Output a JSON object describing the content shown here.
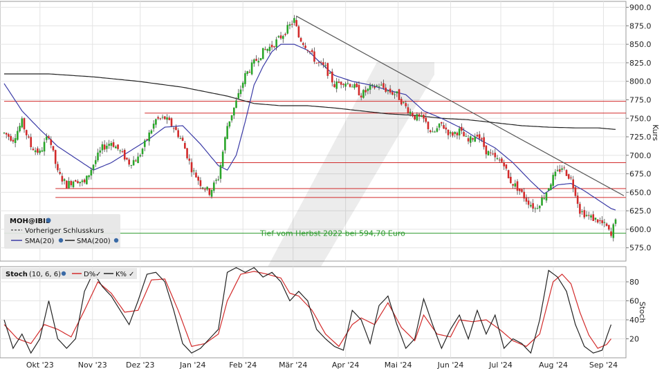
{
  "chart_data": [
    {
      "type": "candlestick",
      "legend": {
        "symbol": "MOH@IBIS",
        "items": [
          {
            "label": "Vorheriger Schlusskurs",
            "color": "#444444",
            "style": "dashed"
          },
          {
            "label": "SMA(20)",
            "color": "#3a3aa6",
            "style": "solid"
          },
          {
            "label": "SMA(200)",
            "color": "#222222",
            "style": "solid"
          }
        ]
      },
      "ylabel": "Kurs",
      "ylim": [
        557,
        908
      ],
      "yticks": [
        575,
        600,
        625,
        650,
        675,
        700,
        725,
        750,
        775,
        800,
        825,
        850,
        875,
        900
      ],
      "ytick_labels": [
        "575.0",
        "600.0",
        "625.0",
        "650.0",
        "675.0",
        "700.0",
        "725.0",
        "750.0",
        "775.0",
        "800.0",
        "825.0",
        "850.0",
        "875.0",
        "900.0"
      ],
      "x_months": [
        "Okt '23",
        "Nov '23",
        "Dez '23",
        "Jan '24",
        "Feb '24",
        "Mär '24",
        "Apr '24",
        "Mai '24",
        "Jun '24",
        "Jul '24",
        "Aug '24",
        "Sep '24"
      ],
      "x_month_pos": [
        15,
        37,
        57,
        79,
        100,
        121,
        143,
        165,
        187,
        208,
        230,
        251
      ],
      "n_days": 275,
      "candles_anchor": [
        [
          0,
          730
        ],
        [
          4,
          722
        ],
        [
          8,
          745
        ],
        [
          12,
          712
        ],
        [
          16,
          703
        ],
        [
          20,
          728
        ],
        [
          24,
          676
        ],
        [
          28,
          660
        ],
        [
          32,
          668
        ],
        [
          36,
          662
        ],
        [
          40,
          688
        ],
        [
          44,
          710
        ],
        [
          48,
          718
        ],
        [
          52,
          705
        ],
        [
          56,
          690
        ],
        [
          60,
          696
        ],
        [
          64,
          722
        ],
        [
          68,
          748
        ],
        [
          72,
          750
        ],
        [
          76,
          738
        ],
        [
          80,
          718
        ],
        [
          84,
          682
        ],
        [
          88,
          662
        ],
        [
          92,
          650
        ],
        [
          96,
          670
        ],
        [
          100,
          740
        ],
        [
          104,
          772
        ],
        [
          108,
          808
        ],
        [
          112,
          825
        ],
        [
          116,
          840
        ],
        [
          120,
          848
        ],
        [
          124,
          860
        ],
        [
          128,
          875
        ],
        [
          130,
          883
        ],
        [
          132,
          860
        ],
        [
          136,
          845
        ],
        [
          140,
          825
        ],
        [
          144,
          818
        ],
        [
          148,
          795
        ],
        [
          152,
          800
        ],
        [
          156,
          795
        ],
        [
          160,
          782
        ],
        [
          164,
          790
        ],
        [
          168,
          795
        ],
        [
          172,
          787
        ],
        [
          176,
          782
        ],
        [
          180,
          765
        ],
        [
          184,
          752
        ],
        [
          188,
          748
        ],
        [
          192,
          728
        ],
        [
          196,
          742
        ],
        [
          200,
          728
        ],
        [
          204,
          733
        ],
        [
          208,
          718
        ],
        [
          212,
          730
        ],
        [
          216,
          706
        ],
        [
          220,
          695
        ],
        [
          224,
          690
        ],
        [
          226,
          668
        ],
        [
          230,
          656
        ],
        [
          234,
          640
        ],
        [
          238,
          628
        ],
        [
          242,
          645
        ],
        [
          246,
          670
        ],
        [
          250,
          684
        ],
        [
          254,
          668
        ],
        [
          256,
          650
        ],
        [
          258,
          625
        ],
        [
          262,
          617
        ],
        [
          266,
          612
        ],
        [
          270,
          603
        ],
        [
          272,
          590
        ],
        [
          274,
          617
        ]
      ],
      "sma20_anchor": [
        [
          0,
          797
        ],
        [
          8,
          760
        ],
        [
          16,
          735
        ],
        [
          24,
          712
        ],
        [
          32,
          696
        ],
        [
          40,
          680
        ],
        [
          48,
          690
        ],
        [
          56,
          705
        ],
        [
          64,
          720
        ],
        [
          72,
          738
        ],
        [
          80,
          740
        ],
        [
          88,
          715
        ],
        [
          96,
          686
        ],
        [
          100,
          680
        ],
        [
          104,
          700
        ],
        [
          108,
          745
        ],
        [
          112,
          795
        ],
        [
          116,
          820
        ],
        [
          120,
          840
        ],
        [
          124,
          850
        ],
        [
          130,
          850
        ],
        [
          136,
          842
        ],
        [
          140,
          830
        ],
        [
          148,
          808
        ],
        [
          156,
          800
        ],
        [
          164,
          795
        ],
        [
          172,
          788
        ],
        [
          180,
          782
        ],
        [
          188,
          760
        ],
        [
          196,
          750
        ],
        [
          204,
          738
        ],
        [
          212,
          723
        ],
        [
          220,
          710
        ],
        [
          228,
          690
        ],
        [
          236,
          665
        ],
        [
          242,
          648
        ],
        [
          248,
          660
        ],
        [
          254,
          662
        ],
        [
          260,
          652
        ],
        [
          266,
          640
        ],
        [
          272,
          628
        ],
        [
          274,
          626
        ]
      ],
      "sma200_anchor": [
        [
          0,
          810
        ],
        [
          20,
          810
        ],
        [
          40,
          806
        ],
        [
          60,
          800
        ],
        [
          80,
          792
        ],
        [
          100,
          780
        ],
        [
          112,
          770
        ],
        [
          124,
          767
        ],
        [
          136,
          767
        ],
        [
          148,
          764
        ],
        [
          160,
          760
        ],
        [
          172,
          756
        ],
        [
          184,
          754
        ],
        [
          196,
          750
        ],
        [
          208,
          748
        ],
        [
          220,
          744
        ],
        [
          232,
          740
        ],
        [
          244,
          738
        ],
        [
          256,
          737
        ],
        [
          266,
          737
        ],
        [
          274,
          735
        ]
      ],
      "horizontal_lines": [
        {
          "y": 773,
          "color": "#d22a2a",
          "x_from": 0
        },
        {
          "y": 757,
          "color": "#d22a2a",
          "x_from": 63
        },
        {
          "y": 690,
          "color": "#d22a2a",
          "x_from": 95
        },
        {
          "y": 655,
          "color": "#d22a2a",
          "x_from": 23
        },
        {
          "y": 643,
          "color": "#d22a2a",
          "x_from": 23
        },
        {
          "y": 594.7,
          "color": "#2c9a2c",
          "x_from": 0
        }
      ],
      "trendline": {
        "from": [
          131,
          888
        ],
        "to": [
          274,
          650
        ],
        "color": "#555555"
      },
      "annotation": {
        "text": "Tief vom Herbst 2022 bei 594,70 Euro",
        "x_day": 126,
        "y": 594.7
      }
    },
    {
      "type": "line",
      "legend": {
        "label": "Stoch",
        "params": "(10, 6, 6)",
        "items": [
          {
            "label": "D%",
            "color": "#d22a2a"
          },
          {
            "label": "K%",
            "color": "#222222"
          }
        ]
      },
      "ylabel": "Stoch",
      "ylim": [
        0,
        96
      ],
      "yticks": [
        20,
        40,
        60,
        80
      ],
      "ytick_labels": [
        "20",
        "40",
        "60",
        "80"
      ],
      "k_anchor": [
        [
          0,
          40
        ],
        [
          4,
          10
        ],
        [
          8,
          25
        ],
        [
          12,
          5
        ],
        [
          16,
          20
        ],
        [
          20,
          60
        ],
        [
          24,
          20
        ],
        [
          28,
          10
        ],
        [
          32,
          20
        ],
        [
          36,
          70
        ],
        [
          40,
          90
        ],
        [
          44,
          75
        ],
        [
          48,
          65
        ],
        [
          52,
          50
        ],
        [
          56,
          35
        ],
        [
          60,
          60
        ],
        [
          64,
          88
        ],
        [
          68,
          90
        ],
        [
          72,
          80
        ],
        [
          76,
          50
        ],
        [
          80,
          15
        ],
        [
          84,
          5
        ],
        [
          88,
          10
        ],
        [
          92,
          20
        ],
        [
          96,
          30
        ],
        [
          100,
          90
        ],
        [
          104,
          95
        ],
        [
          108,
          90
        ],
        [
          112,
          95
        ],
        [
          116,
          85
        ],
        [
          120,
          90
        ],
        [
          124,
          80
        ],
        [
          128,
          60
        ],
        [
          132,
          70
        ],
        [
          136,
          60
        ],
        [
          140,
          30
        ],
        [
          144,
          20
        ],
        [
          148,
          12
        ],
        [
          152,
          8
        ],
        [
          156,
          50
        ],
        [
          160,
          40
        ],
        [
          164,
          15
        ],
        [
          168,
          55
        ],
        [
          172,
          65
        ],
        [
          176,
          35
        ],
        [
          180,
          10
        ],
        [
          184,
          20
        ],
        [
          188,
          62
        ],
        [
          192,
          35
        ],
        [
          196,
          10
        ],
        [
          200,
          30
        ],
        [
          204,
          45
        ],
        [
          208,
          20
        ],
        [
          212,
          50
        ],
        [
          216,
          25
        ],
        [
          220,
          45
        ],
        [
          224,
          10
        ],
        [
          228,
          20
        ],
        [
          232,
          15
        ],
        [
          236,
          5
        ],
        [
          240,
          40
        ],
        [
          244,
          92
        ],
        [
          248,
          85
        ],
        [
          252,
          70
        ],
        [
          256,
          35
        ],
        [
          260,
          12
        ],
        [
          264,
          5
        ],
        [
          268,
          8
        ],
        [
          270,
          22
        ],
        [
          272,
          35
        ]
      ],
      "d_anchor": [
        [
          0,
          35
        ],
        [
          6,
          20
        ],
        [
          12,
          15
        ],
        [
          18,
          35
        ],
        [
          24,
          30
        ],
        [
          30,
          22
        ],
        [
          36,
          50
        ],
        [
          42,
          80
        ],
        [
          48,
          68
        ],
        [
          54,
          48
        ],
        [
          60,
          50
        ],
        [
          66,
          82
        ],
        [
          72,
          83
        ],
        [
          78,
          50
        ],
        [
          84,
          12
        ],
        [
          90,
          15
        ],
        [
          96,
          25
        ],
        [
          100,
          60
        ],
        [
          106,
          88
        ],
        [
          112,
          91
        ],
        [
          118,
          88
        ],
        [
          124,
          84
        ],
        [
          128,
          68
        ],
        [
          132,
          65
        ],
        [
          138,
          50
        ],
        [
          144,
          25
        ],
        [
          150,
          12
        ],
        [
          156,
          35
        ],
        [
          160,
          42
        ],
        [
          166,
          35
        ],
        [
          172,
          58
        ],
        [
          178,
          32
        ],
        [
          184,
          18
        ],
        [
          188,
          45
        ],
        [
          194,
          25
        ],
        [
          200,
          22
        ],
        [
          204,
          40
        ],
        [
          210,
          38
        ],
        [
          216,
          40
        ],
        [
          222,
          30
        ],
        [
          228,
          18
        ],
        [
          234,
          12
        ],
        [
          240,
          25
        ],
        [
          246,
          80
        ],
        [
          250,
          88
        ],
        [
          254,
          78
        ],
        [
          258,
          48
        ],
        [
          262,
          24
        ],
        [
          266,
          10
        ],
        [
          270,
          14
        ],
        [
          272,
          20
        ]
      ]
    }
  ]
}
